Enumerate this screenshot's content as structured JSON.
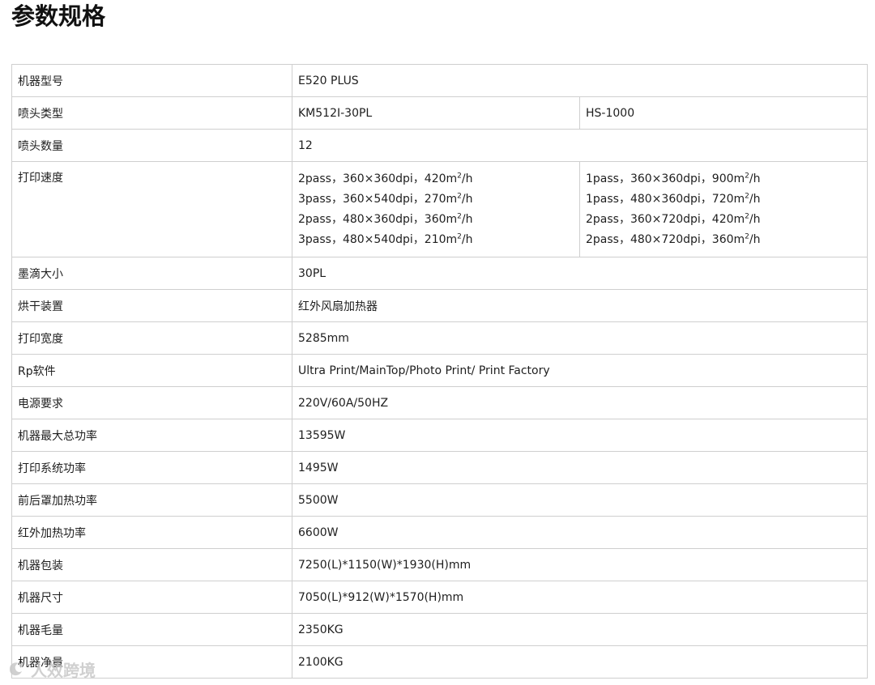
{
  "page": {
    "title": "参数规格"
  },
  "spec_table": {
    "rows": [
      {
        "label": "机器型号",
        "value": "E520 PLUS"
      },
      {
        "label": "喷头类型",
        "values": [
          "KM512I-30PL",
          "HS-1000"
        ]
      },
      {
        "label": "喷头数量",
        "value": "12"
      },
      {
        "label": "打印速度",
        "columns": [
          [
            {
              "text": "2pass，360×360dpi，420m",
              "sup": "2",
              "suffix": "/h"
            },
            {
              "text": "3pass，360×540dpi，270m",
              "sup": "2",
              "suffix": "/h"
            },
            {
              "text": "2pass，480×360dpi，360m",
              "sup": "2",
              "suffix": "/h"
            },
            {
              "text": "3pass，480×540dpi，210m",
              "sup": "2",
              "suffix": "/h"
            }
          ],
          [
            {
              "text": "1pass，360×360dpi，900m",
              "sup": "2",
              "suffix": "/h"
            },
            {
              "text": "1pass，480×360dpi，720m",
              "sup": "2",
              "suffix": "/h"
            },
            {
              "text": "2pass，360×720dpi，420m",
              "sup": "2",
              "suffix": "/h"
            },
            {
              "text": "2pass，480×720dpi，360m",
              "sup": "2",
              "suffix": "/h"
            }
          ]
        ]
      },
      {
        "label": "墨滴大小",
        "value": "30PL"
      },
      {
        "label": "烘干装置",
        "value": "红外风扇加热器"
      },
      {
        "label": "打印宽度",
        "value": "5285mm"
      },
      {
        "label": "Rp软件",
        "value": "Ultra Print/MainTop/Photo Print/ Print Factory"
      },
      {
        "label": "电源要求",
        "value": "220V/60A/50HZ"
      },
      {
        "label": "机器最大总功率",
        "value": "13595W"
      },
      {
        "label": "打印系统功率",
        "value": "1495W"
      },
      {
        "label": "前后罩加热功率",
        "value": "5500W"
      },
      {
        "label": "红外加热功率",
        "value": "6600W"
      },
      {
        "label": "机器包装",
        "value": "7250(L)*1150(W)*1930(H)mm"
      },
      {
        "label": "机器尺寸",
        "value": "7050(L)*912(W)*1570(H)mm"
      },
      {
        "label": "机器毛量",
        "value": "2350KG"
      },
      {
        "label": "机器净量",
        "value": "2100KG"
      }
    ]
  },
  "watermark": {
    "text": "人效跨境",
    "icon": "watermark-logo-icon"
  },
  "colors": {
    "border": "#cfcfcf",
    "text": "#1e1e1e",
    "watermark": "#c8c8c8"
  }
}
